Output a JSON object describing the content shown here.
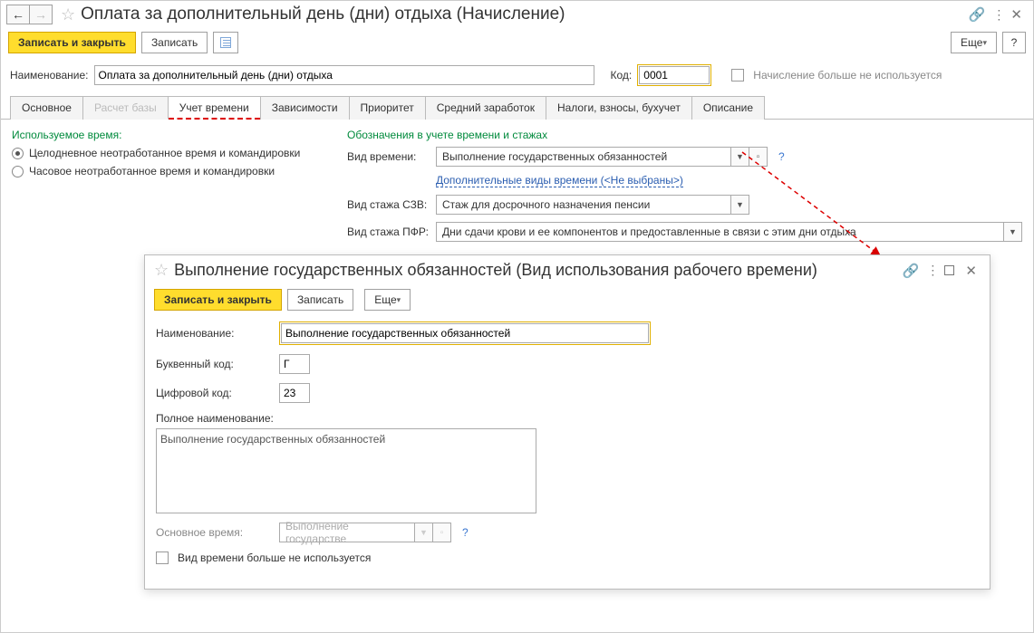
{
  "main": {
    "title": "Оплата за дополнительный день (дни) отдыха (Начисление)",
    "toolbar": {
      "save_close": "Записать и закрыть",
      "save": "Записать",
      "more": "Еще",
      "help": "?"
    },
    "fields": {
      "name_label": "Наименование:",
      "name_value": "Оплата за дополнительный день (дни) отдыха",
      "code_label": "Код:",
      "code_value": "0001",
      "deprecated_label": "Начисление больше не используется"
    },
    "tabs": [
      {
        "label": "Основное"
      },
      {
        "label": "Расчет базы"
      },
      {
        "label": "Учет времени"
      },
      {
        "label": "Зависимости"
      },
      {
        "label": "Приоритет"
      },
      {
        "label": "Средний заработок"
      },
      {
        "label": "Налоги, взносы, бухучет"
      },
      {
        "label": "Описание"
      }
    ],
    "left": {
      "section": "Используемое время:",
      "radio1": "Целодневное неотработанное время и командировки",
      "radio2": "Часовое неотработанное время и командировки"
    },
    "right": {
      "section": "Обозначения в учете времени и стажах",
      "time_kind_label": "Вид времени:",
      "time_kind_value": "Выполнение государственных обязанностей",
      "q": "?",
      "extra_kinds": "Дополнительные виды времени (<Не выбраны>)",
      "szv_label": "Вид стажа СЗВ:",
      "szv_value": "Стаж для досрочного назначения пенсии",
      "pfr_label": "Вид стажа ПФР:",
      "pfr_value": "Дни сдачи крови и ее компонентов и предоставленные в связи с этим дни отдыха"
    }
  },
  "inner": {
    "title": "Выполнение государственных обязанностей (Вид использования рабочего времени)",
    "toolbar": {
      "save_close": "Записать и закрыть",
      "save": "Записать",
      "more": "Еще"
    },
    "fields": {
      "name_label": "Наименование:",
      "name_value": "Выполнение государственных обязанностей",
      "letter_label": "Буквенный код:",
      "letter_value": "Г",
      "digit_label": "Цифровой код:",
      "digit_value": "23",
      "full_label": "Полное наименование:",
      "full_value": "Выполнение государственных обязанностей",
      "base_label": "Основное время:",
      "base_value": "Выполнение государстве",
      "q": "?",
      "deprecated_label": "Вид времени больше не используется"
    }
  }
}
